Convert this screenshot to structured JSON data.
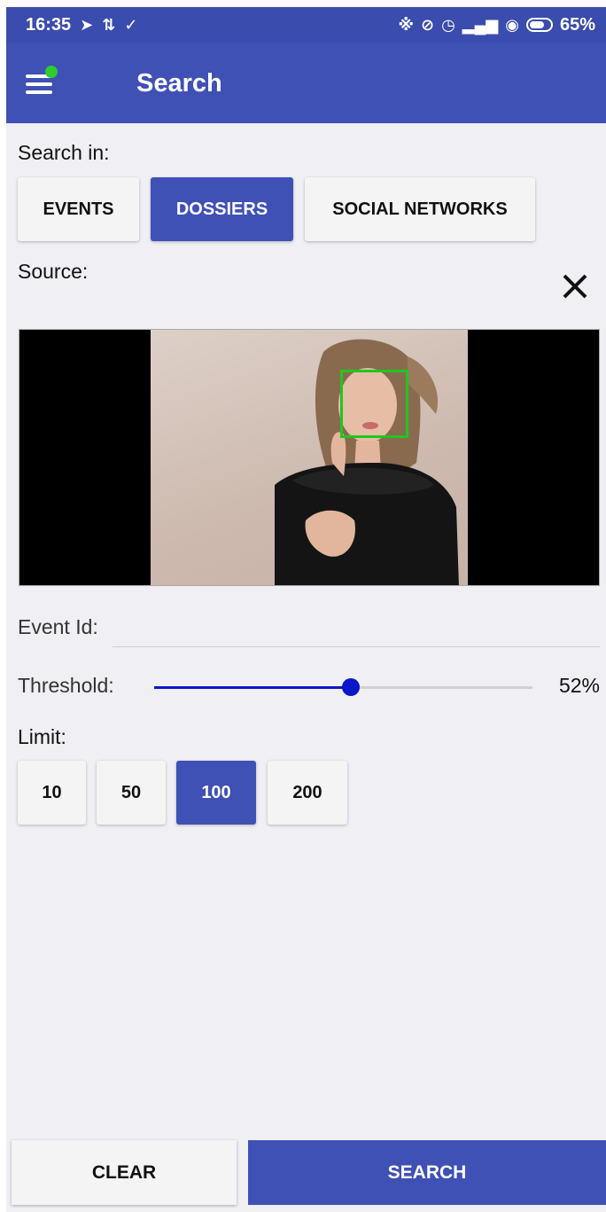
{
  "status_bar": {
    "time": "16:35",
    "battery": "65%",
    "icons": [
      "navigation-icon",
      "sync-icon",
      "download-done-icon",
      "bluetooth-icon",
      "mute-icon",
      "alarm-icon",
      "signal-icon",
      "wifi-icon",
      "battery-icon"
    ]
  },
  "app_bar": {
    "title": "Search",
    "menu_icon": "hamburger-menu-icon",
    "notification_dot_color": "#2ecc2e"
  },
  "search_in": {
    "label": "Search in:",
    "options": [
      "EVENTS",
      "DOSSIERS",
      "SOCIAL NETWORKS"
    ],
    "selected": "DOSSIERS"
  },
  "source": {
    "label": "Source:",
    "clear_icon": "close-icon"
  },
  "event_id": {
    "label": "Event Id:",
    "value": ""
  },
  "threshold": {
    "label": "Threshold:",
    "value_text": "52%",
    "value": 0.52
  },
  "limit": {
    "label": "Limit:",
    "options": [
      "10",
      "50",
      "100",
      "200"
    ],
    "selected": "100"
  },
  "actions": {
    "clear": "CLEAR",
    "search": "SEARCH"
  },
  "colors": {
    "primary": "#3f51b5",
    "slider": "#0b16c9",
    "face_box": "#1ec81e"
  }
}
